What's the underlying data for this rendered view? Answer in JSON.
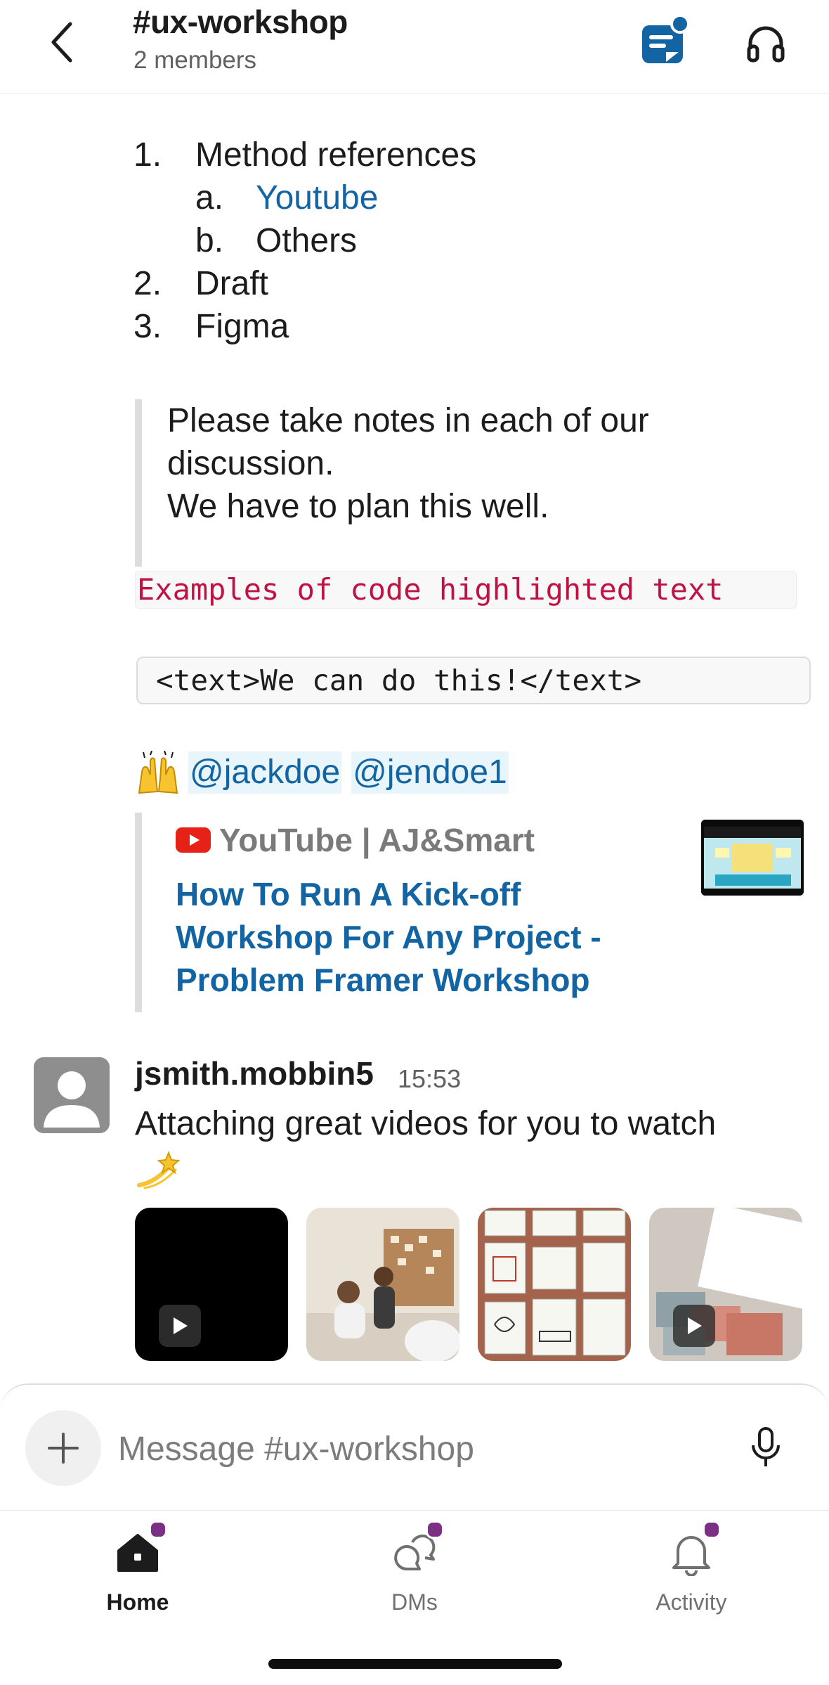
{
  "header": {
    "title": "#ux-workshop",
    "subtitle": "2 members"
  },
  "message_list": {
    "items": [
      {
        "num": "1.",
        "text": "Method references",
        "level": 0
      },
      {
        "num": "a.",
        "text": "Youtube",
        "level": 1,
        "link": true
      },
      {
        "num": "b.",
        "text": "Others",
        "level": 1
      },
      {
        "num": "2.",
        "text": "Draft",
        "level": 0
      },
      {
        "num": "3.",
        "text": "Figma",
        "level": 0
      }
    ],
    "quote_lines": [
      "Please take notes in each of our",
      "discussion.",
      "We have to plan this well."
    ],
    "inline_code": "Examples of code highlighted text",
    "code_block": "<text>We can do this!</text>",
    "mentions": [
      "@jackdoe",
      "@jendoe1"
    ]
  },
  "unfurl": {
    "source": "YouTube | AJ&Smart",
    "title_lines": [
      "How To Run A Kick-off",
      "Workshop For Any Project -",
      "Problem Framer Workshop"
    ]
  },
  "message": {
    "author": "jsmith.mobbin5",
    "time": "15:53",
    "text": "Attaching great videos for you to watch",
    "attachments": [
      {
        "kind": "video",
        "thumb": "black"
      },
      {
        "kind": "image",
        "thumb": "office meeting"
      },
      {
        "kind": "image",
        "thumb": "sticky notes board"
      },
      {
        "kind": "video",
        "thumb": "paper swatches"
      }
    ]
  },
  "composer": {
    "placeholder": "Message #ux-workshop"
  },
  "tabs": [
    {
      "label": "Home",
      "icon": "home-icon",
      "active": true
    },
    {
      "label": "DMs",
      "icon": "dms-icon",
      "active": false
    },
    {
      "label": "Activity",
      "icon": "bell-icon",
      "active": false
    }
  ],
  "colors": {
    "link": "#1264a3",
    "code": "#c01343",
    "badge": "#7c3085",
    "canvas_icon": "#1264a3"
  }
}
